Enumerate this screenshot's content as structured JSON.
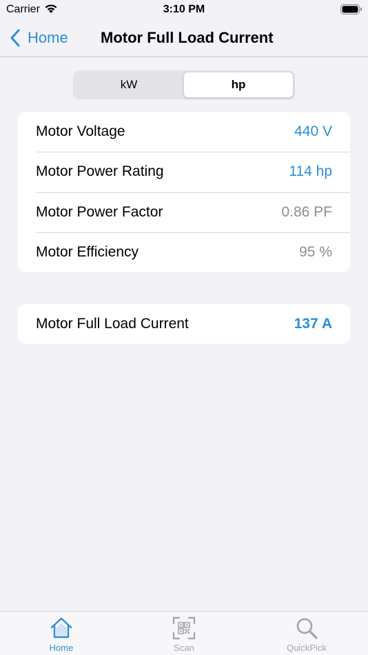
{
  "status_bar": {
    "carrier": "Carrier",
    "time": "3:10 PM"
  },
  "nav": {
    "back_label": "Home",
    "title": "Motor Full Load Current"
  },
  "unit_toggle": {
    "options": [
      "kW",
      "hp"
    ],
    "selected": "hp"
  },
  "inputs": [
    {
      "label": "Motor Voltage",
      "value": "440 V",
      "color": "#2b8fd6"
    },
    {
      "label": "Motor Power Rating",
      "value": "114 hp",
      "color": "#2b8fd6"
    },
    {
      "label": "Motor Power Factor",
      "value": "0.86 PF",
      "color": "#8e8e93"
    },
    {
      "label": "Motor Efficiency",
      "value": "95 %",
      "color": "#8e8e93"
    }
  ],
  "result": {
    "label": "Motor Full Load Current",
    "value": "137 A",
    "color": "#2b8fd6"
  },
  "tab_bar": {
    "tabs": [
      {
        "label": "Home",
        "icon": "house-icon",
        "active": true
      },
      {
        "label": "Scan",
        "icon": "qr-scan-icon",
        "active": false
      },
      {
        "label": "QuickPick",
        "icon": "magnifier-icon",
        "active": false
      }
    ],
    "active_color": "#2b8fd6",
    "inactive_color": "#a7a7ab"
  }
}
